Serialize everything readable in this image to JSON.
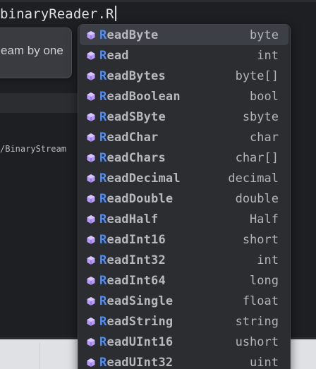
{
  "editor": {
    "code_line": "binaryReader.R",
    "doc_tooltip_text": "eam by one",
    "side_label": "/BinaryStream"
  },
  "completion": {
    "typed_prefix": "R",
    "items": [
      {
        "prefix": "R",
        "rest": "eadByte",
        "type": "byte",
        "icon": "method-cube-icon",
        "selected": true
      },
      {
        "prefix": "R",
        "rest": "ead",
        "type": "int",
        "icon": "method-cube-icon"
      },
      {
        "prefix": "R",
        "rest": "eadBytes",
        "type": "byte[]",
        "icon": "method-cube-icon"
      },
      {
        "prefix": "R",
        "rest": "eadBoolean",
        "type": "bool",
        "icon": "method-cube-icon"
      },
      {
        "prefix": "R",
        "rest": "eadSByte",
        "type": "sbyte",
        "icon": "method-cube-icon"
      },
      {
        "prefix": "R",
        "rest": "eadChar",
        "type": "char",
        "icon": "method-cube-icon"
      },
      {
        "prefix": "R",
        "rest": "eadChars",
        "type": "char[]",
        "icon": "method-cube-icon"
      },
      {
        "prefix": "R",
        "rest": "eadDecimal",
        "type": "decimal",
        "icon": "method-cube-icon"
      },
      {
        "prefix": "R",
        "rest": "eadDouble",
        "type": "double",
        "icon": "method-cube-icon"
      },
      {
        "prefix": "R",
        "rest": "eadHalf",
        "type": "Half",
        "icon": "method-cube-icon"
      },
      {
        "prefix": "R",
        "rest": "eadInt16",
        "type": "short",
        "icon": "method-cube-icon"
      },
      {
        "prefix": "R",
        "rest": "eadInt32",
        "type": "int",
        "icon": "method-cube-icon"
      },
      {
        "prefix": "R",
        "rest": "eadInt64",
        "type": "long",
        "icon": "method-cube-icon"
      },
      {
        "prefix": "R",
        "rest": "eadSingle",
        "type": "float",
        "icon": "method-cube-icon"
      },
      {
        "prefix": "R",
        "rest": "eadString",
        "type": "string",
        "icon": "method-cube-icon"
      },
      {
        "prefix": "R",
        "rest": "eadUInt16",
        "type": "ushort",
        "icon": "method-cube-icon"
      },
      {
        "prefix": "R",
        "rest": "eadUInt32",
        "type": "uint",
        "icon": "method-cube-icon"
      }
    ]
  },
  "colors": {
    "match_highlight": "#4f8ef7",
    "method_icon": "#b99bf8",
    "popup_background": "#2b2d30",
    "selected_row": "#3c3f45"
  }
}
